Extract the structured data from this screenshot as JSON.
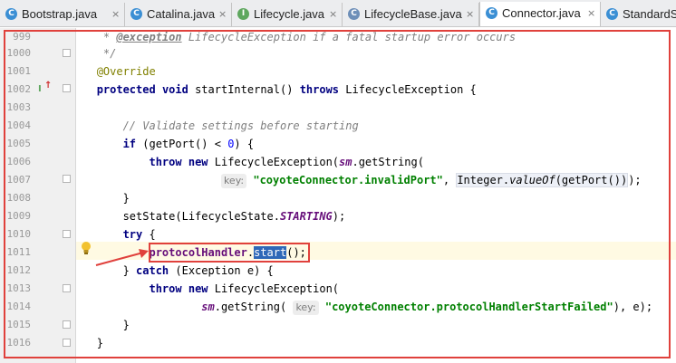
{
  "tabs": [
    {
      "icon": "class-c-icon",
      "label": "Bootstrap.java",
      "active": false
    },
    {
      "icon": "class-c-icon",
      "label": "Catalina.java",
      "active": false
    },
    {
      "icon": "interface-i-icon",
      "label": "Lifecycle.java",
      "active": false
    },
    {
      "icon": "abstract-class-c-icon",
      "label": "LifecycleBase.java",
      "active": false
    },
    {
      "icon": "class-c-icon",
      "label": "Connector.java",
      "active": true
    },
    {
      "icon": "class-c-icon",
      "label": "StandardS",
      "active": false
    }
  ],
  "tab_close_glyph": "×",
  "line_numbers": [
    "999",
    "1000",
    "1001",
    "1002",
    "1003",
    "1004",
    "1005",
    "1006",
    "1007",
    "1008",
    "1009",
    "1010",
    "1011",
    "1012",
    "1013",
    "1014",
    "1015",
    "1016"
  ],
  "code": {
    "l999": {
      "star": "* ",
      "tag": "@exception",
      "type": " LifecycleException",
      "rest": " if a fatal startup error occurs"
    },
    "l1000": "*/",
    "l1001": "@Override",
    "l1002": {
      "kw1": "protected",
      "kw2": "void",
      "name": " startInternal() ",
      "kw3": "throws",
      "rest": " LifecycleException {"
    },
    "l1004": "// Validate settings before starting",
    "l1005": {
      "kw": "if",
      "a": " (getPort() < ",
      "num": "0",
      "b": ") {"
    },
    "l1006": {
      "kw1": "throw",
      "kw2": "new",
      "a": " LifecycleException(",
      "sm": "sm",
      "b": ".getString("
    },
    "l1007": {
      "hint": "key:",
      "str": "\"coyoteConnector.invalidPort\"",
      "comma": ", ",
      "call_a": "Integer.",
      "call_m": "valueOf",
      "call_b": "(getPort())",
      "end": ");"
    },
    "l1008": "}",
    "l1009": {
      "a": "setState(LifecycleState.",
      "stat": "STARTING",
      "b": ");"
    },
    "l1010": {
      "kw": "try",
      "rest": " {"
    },
    "l1011": {
      "field": "protocolHandler",
      "dot": ".",
      "method": "start",
      "rest": "();"
    },
    "l1012": {
      "a": "} ",
      "kw": "catch",
      "b": " (Exception e) {"
    },
    "l1013": {
      "kw1": "throw",
      "kw2": "new",
      "rest": " LifecycleException("
    },
    "l1014": {
      "sm": "sm",
      "a": ".getString( ",
      "hint": "key:",
      "str": "\"coyoteConnector.protocolHandlerStartFailed\"",
      "b": "), e);"
    },
    "l1015": "}",
    "l1016": "}"
  },
  "gutter_icons": {
    "implements": "I",
    "arrow": "↑"
  },
  "colors": {
    "keyword": "#000080",
    "string": "#008000",
    "annotation": "#808000",
    "comment": "#808080",
    "highlight": "#e0413c",
    "selection": "#2e68b8"
  }
}
